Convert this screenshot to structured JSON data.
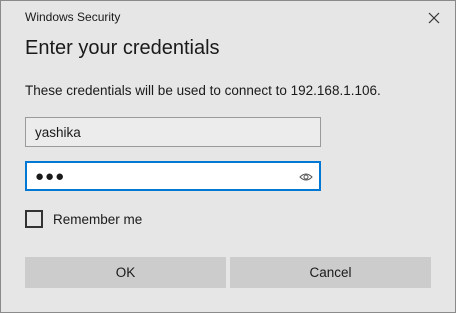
{
  "window": {
    "title": "Windows Security",
    "close_icon": "close-icon"
  },
  "dialog": {
    "heading": "Enter your credentials",
    "message": "These credentials will be used to connect to 192.168.1.106."
  },
  "username": {
    "value": "yashika"
  },
  "password": {
    "masked_value": "●●●",
    "reveal_icon": "eye-icon"
  },
  "remember": {
    "label": "Remember me",
    "checked": false
  },
  "buttons": {
    "ok": "OK",
    "cancel": "Cancel"
  },
  "colors": {
    "background": "#e6e6e6",
    "accent": "#0078d4",
    "button": "#cccccc"
  }
}
